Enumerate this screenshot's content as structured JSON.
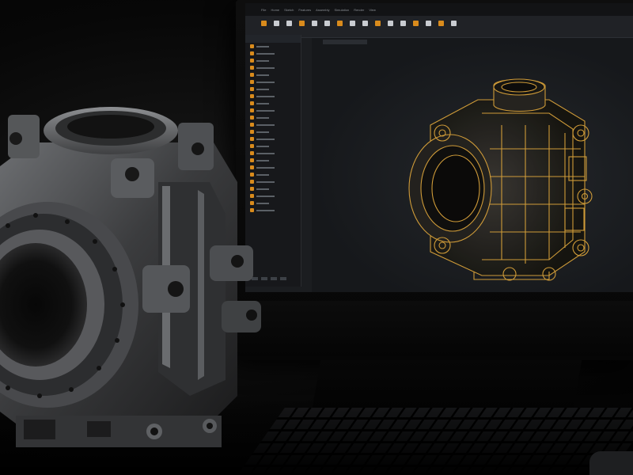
{
  "scene": {
    "description_label": "",
    "colors": {
      "metal_dark": "#2e2f31",
      "metal_mid": "#4b4d50",
      "metal_light": "#8a8c8f",
      "wireframe_gold": "#d9a23a",
      "screen_bg": "#1b1d20",
      "panel_icon": "#d98b1c"
    }
  },
  "cad_app": {
    "menu": [
      "File",
      "Home",
      "Sketch",
      "Features",
      "Assembly",
      "Simulation",
      "Render",
      "View"
    ],
    "ribbon_tools": [
      {
        "icon": "new-icon",
        "color": "#d98b1c"
      },
      {
        "icon": "open-icon",
        "color": "#c9ccd1"
      },
      {
        "icon": "save-icon",
        "color": "#c9ccd1"
      },
      {
        "icon": "sketch-icon",
        "color": "#d98b1c"
      },
      {
        "icon": "extrude-icon",
        "color": "#c9ccd1"
      },
      {
        "icon": "revolve-icon",
        "color": "#c9ccd1"
      },
      {
        "icon": "fillet-icon",
        "color": "#d98b1c"
      },
      {
        "icon": "chamfer-icon",
        "color": "#c9ccd1"
      },
      {
        "icon": "hole-icon",
        "color": "#c9ccd1"
      },
      {
        "icon": "pattern-icon",
        "color": "#d98b1c"
      },
      {
        "icon": "mirror-icon",
        "color": "#c9ccd1"
      },
      {
        "icon": "shell-icon",
        "color": "#c9ccd1"
      },
      {
        "icon": "measure-icon",
        "color": "#d98b1c"
      },
      {
        "icon": "section-icon",
        "color": "#c9ccd1"
      },
      {
        "icon": "render-icon",
        "color": "#d98b1c"
      },
      {
        "icon": "settings-icon",
        "color": "#c9ccd1"
      }
    ],
    "tree_item_count": 24
  }
}
